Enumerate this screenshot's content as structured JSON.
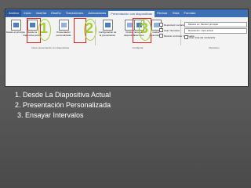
{
  "menu": {
    "tabs": [
      "Archivo",
      "Inicio",
      "Insertar",
      "Diseño",
      "Transiciones",
      "Animaciones",
      "Presentación con diapositivas",
      "Revisar",
      "Vista",
      "Formato"
    ]
  },
  "ribbon": {
    "commands": [
      {
        "label": "Desde el principio",
        "alt": false
      },
      {
        "label": "Desde la diapositiva actual",
        "alt": false
      },
      {
        "label": "Presentación personalizada",
        "alt": true
      },
      {
        "label": "Configuración de la presentación",
        "alt": false
      },
      {
        "label": "Ocultar diapositiva",
        "alt": true
      },
      {
        "label": "Ensayar intervalos",
        "alt": false
      },
      {
        "label": "Grabar presentación",
        "alt": true
      }
    ],
    "markers": [
      "1",
      "2",
      "3"
    ],
    "checkboxes": [
      "Reproducir narraciones",
      "Usar intervalos",
      "Mostrar controles multimedia"
    ],
    "monitor_dropdowns": [
      "Mostrar en: Monitor principal",
      "Resolución: Usar actual"
    ],
    "presenter_view": "Usar vista del moderador",
    "group_labels": [
      "Iniciar presentación con diapositivas",
      "Configurar",
      "Monitores"
    ]
  },
  "items": [
    "1. Desde La Diapositiva Actual",
    "2. Presentación Personalizada",
    "3. Ensayar Intervalos"
  ],
  "colors": {
    "background": "#585858",
    "highlight_box": "#e0241c",
    "step_marker": "#a2cf2d",
    "menubar": "#3c6fb3"
  }
}
